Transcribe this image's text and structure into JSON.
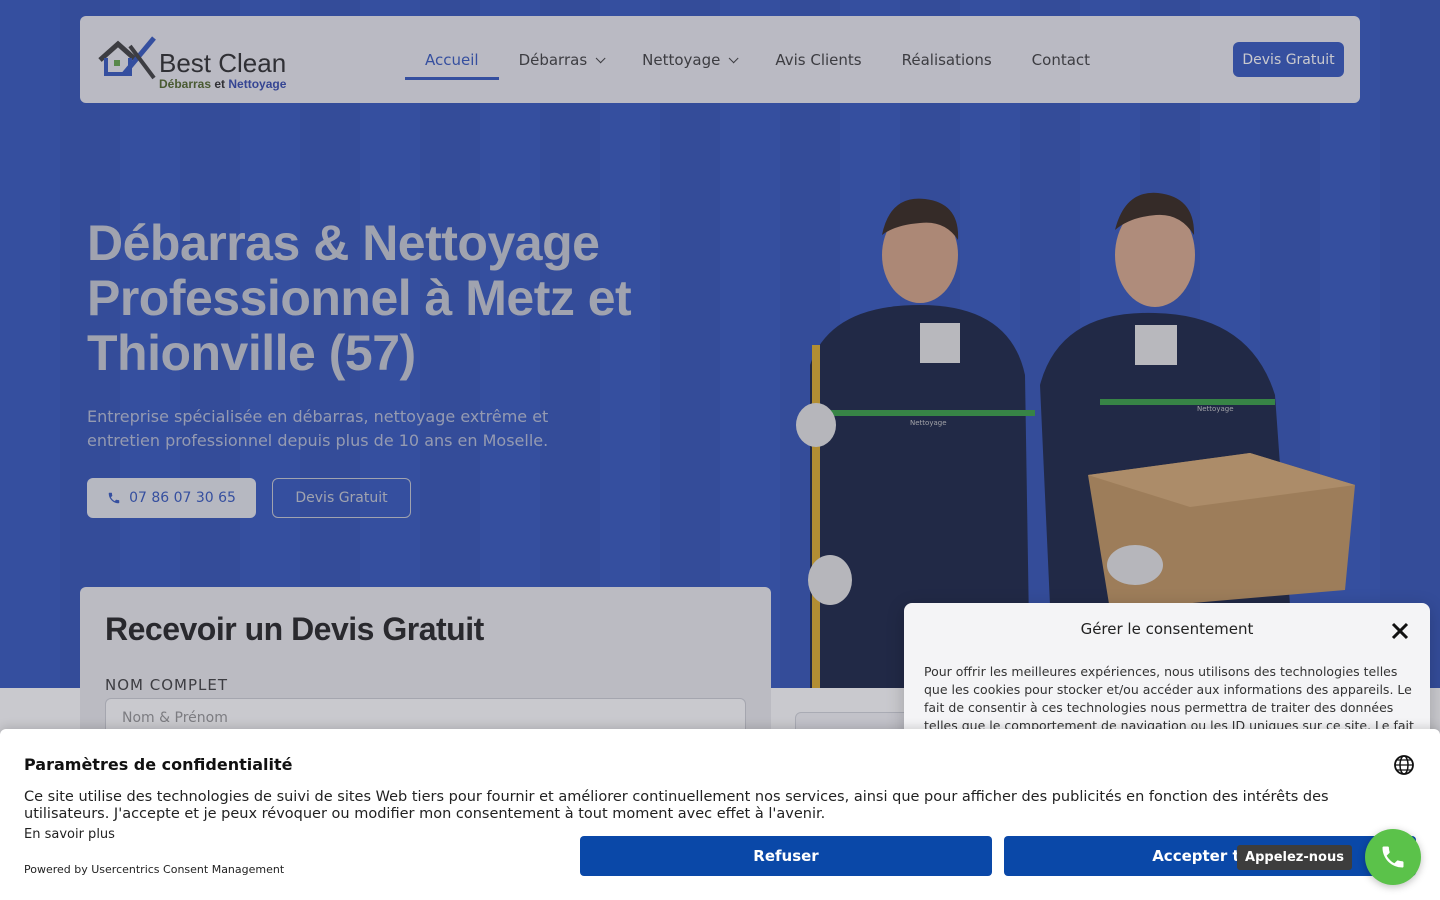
{
  "header": {
    "logo": {
      "name": "Best Clean",
      "tag_part1": "Débarras",
      "tag_part2": "et",
      "tag_part3": "Nettoyage"
    },
    "nav": [
      {
        "label": "Accueil",
        "active": true,
        "dropdown": false
      },
      {
        "label": "Débarras",
        "active": false,
        "dropdown": true
      },
      {
        "label": "Nettoyage",
        "active": false,
        "dropdown": true
      },
      {
        "label": "Avis Clients",
        "active": false,
        "dropdown": false
      },
      {
        "label": "Réalisations",
        "active": false,
        "dropdown": false
      },
      {
        "label": "Contact",
        "active": false,
        "dropdown": false
      }
    ],
    "cta_label": "Devis Gratuit"
  },
  "hero": {
    "title": "Débarras & Nettoyage Professionnel à Metz et Thionville (57)",
    "subtitle": "Entreprise spécialisée en débarras, nettoyage extrême et entretien professionnel depuis plus de 10 ans en Moselle.",
    "phone_label": "07 86 07 30 65",
    "devis_label": "Devis Gratuit",
    "worker_badge_1": "Nettoyage",
    "worker_badge_2": "Nettoyage"
  },
  "quote_form": {
    "title": "Recevoir un Devis Gratuit",
    "name_label": "NOM COMPLET",
    "name_placeholder": "Nom & Prénom"
  },
  "consent_modal": {
    "title": "Gérer le consentement",
    "body": "Pour offrir les meilleures expériences, nous utilisons des technologies telles que les cookies pour stocker et/ou accéder aux informations des appareils. Le fait de consentir à ces technologies nous permettra de traiter des données telles que le comportement de navigation ou les ID uniques sur ce site. Le fait de ne pas"
  },
  "cookie_banner": {
    "title": "Paramètres de confidentialité",
    "text": "Ce site utilise des technologies de suivi de sites Web tiers pour fournir et améliorer continuellement nos services, ainsi que pour afficher des publicités en fonction des intérêts des utilisateurs. J'accepte et je peux révoquer ou modifier mon consentement à tout moment avec effet à l'avenir.",
    "more_label": "En savoir plus",
    "powered_label": "Powered by Usercentrics Consent Management",
    "refuse_label": "Refuser",
    "accept_label": "Accepter tout"
  },
  "call_widget": {
    "label": "Appelez-nous"
  },
  "colors": {
    "brand_blue": "#3a5cc0",
    "button_blue": "#0a48a8",
    "call_green": "#5bc24a"
  }
}
